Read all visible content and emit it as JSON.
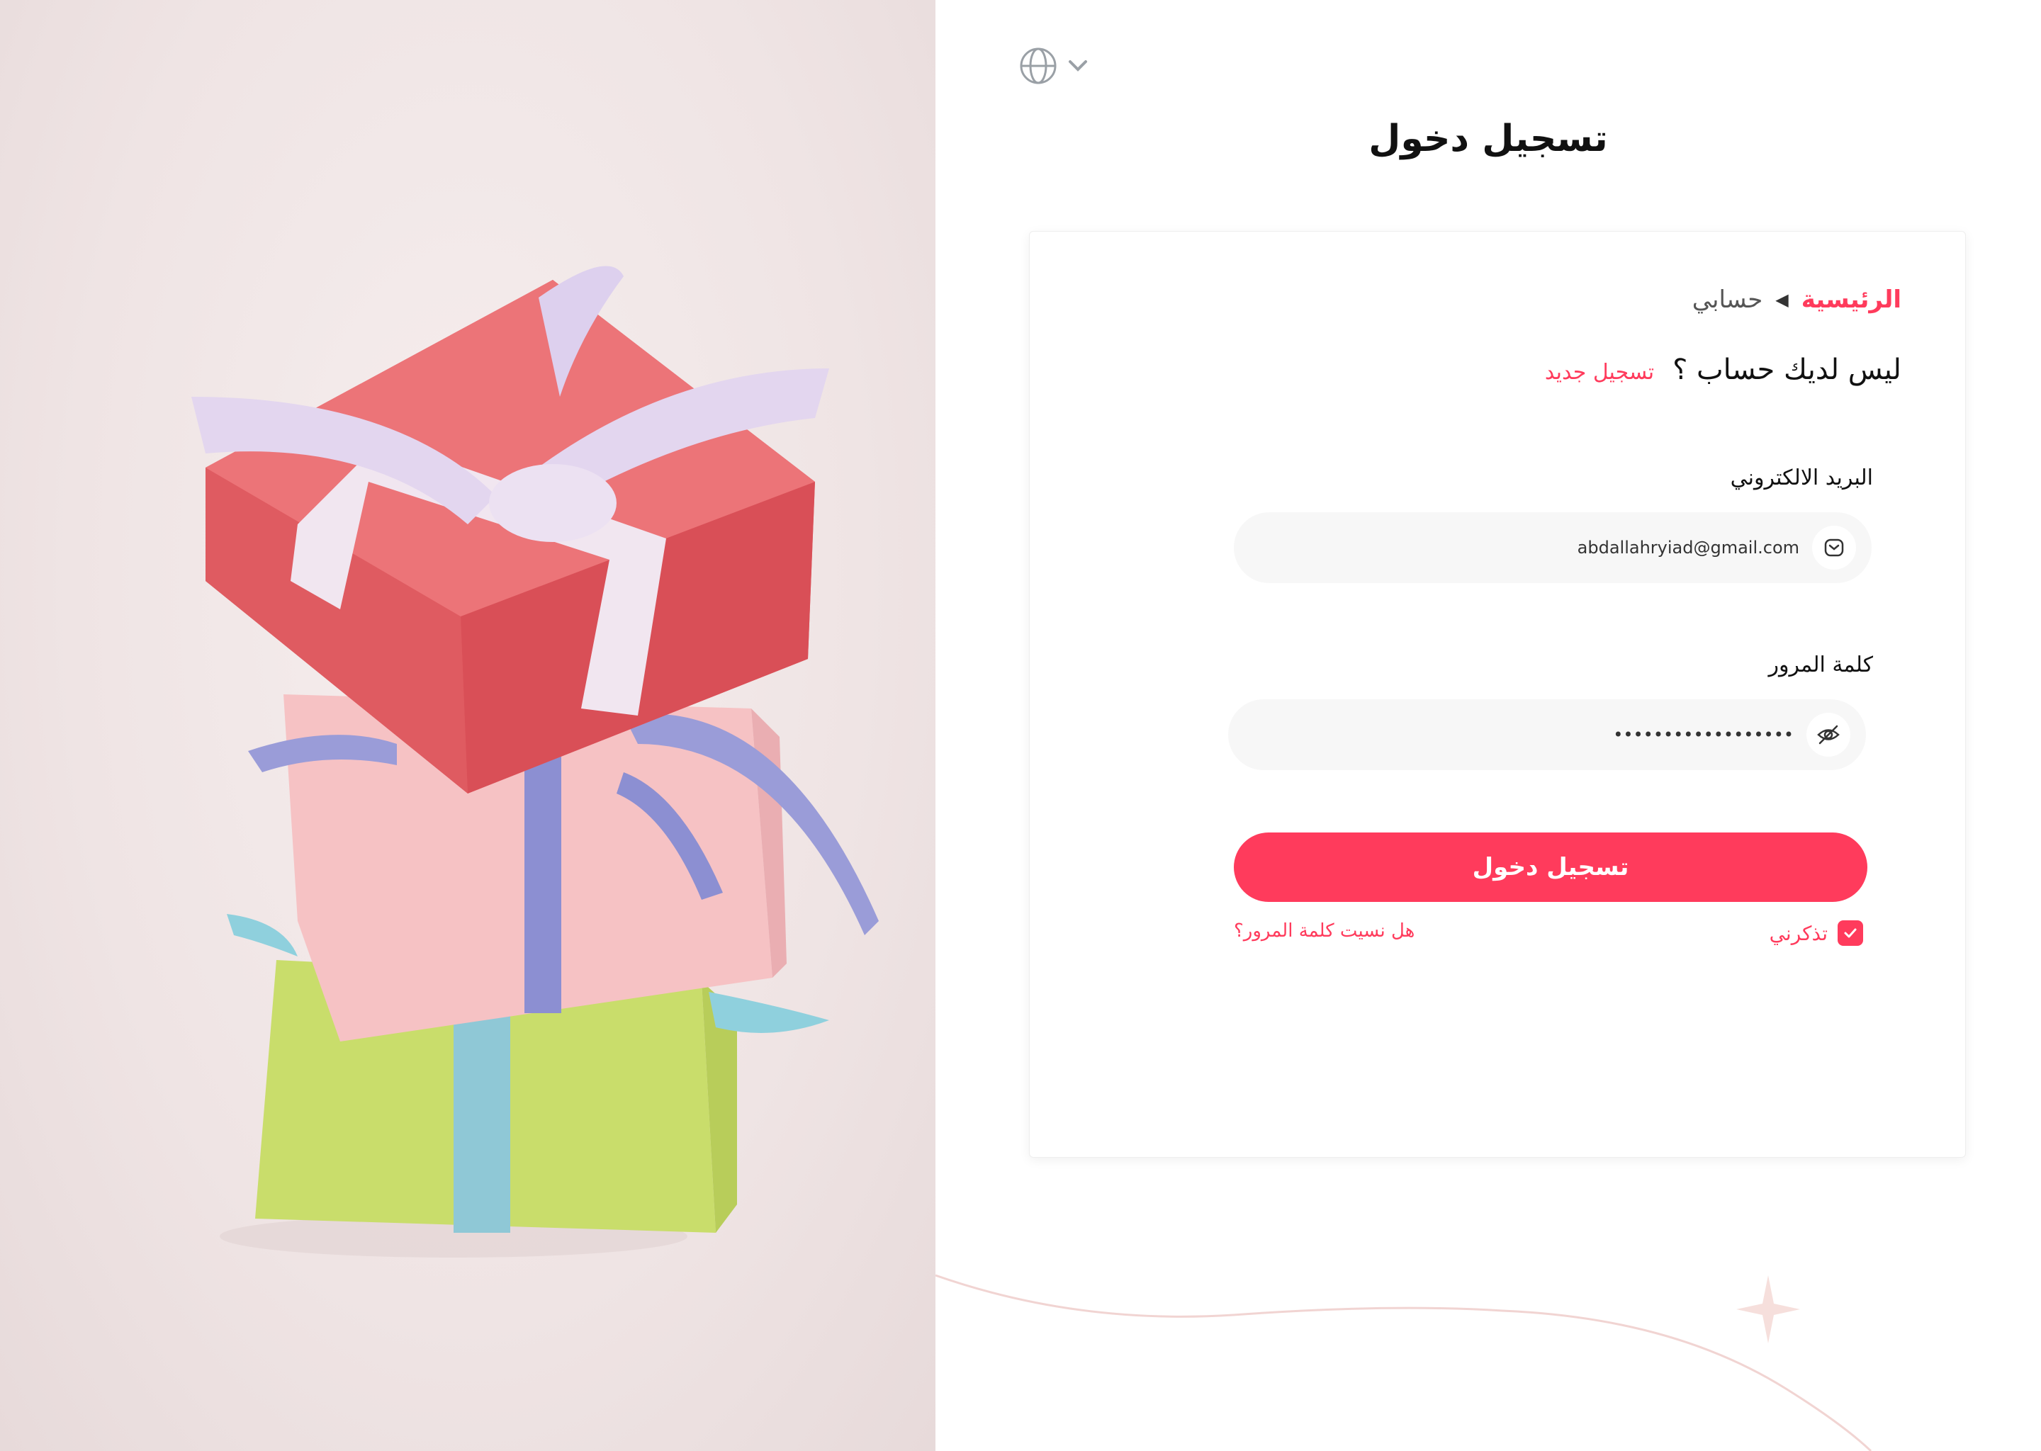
{
  "language_selector": {
    "icon": "globe-icon",
    "chevron": "chevron-down-icon"
  },
  "page": {
    "title": "تسجيل دخول"
  },
  "breadcrumb": {
    "home": "الرئيسية",
    "separator_icon": "caret-left-icon",
    "current": "حسابي"
  },
  "signup": {
    "question": "ليس لديك حساب ؟",
    "link": "تسجيل جديد"
  },
  "form": {
    "email_label": "البريد الالكتروني",
    "email_value": "abdallahryiad@gmail.com",
    "email_icon": "mail-icon",
    "password_label": "كلمة المرور",
    "password_value": "••••••••••••••••••",
    "password_icon": "eye-off-icon",
    "submit_label": "تسجيل دخول",
    "remember_label": "تذكرني",
    "remember_checked": true,
    "forgot_label": "هل نسيت كلمة المرور؟"
  },
  "colors": {
    "accent": "#ff3b5c",
    "field_bg": "#f7f7f7",
    "deco_line": "#f1d4d2"
  }
}
